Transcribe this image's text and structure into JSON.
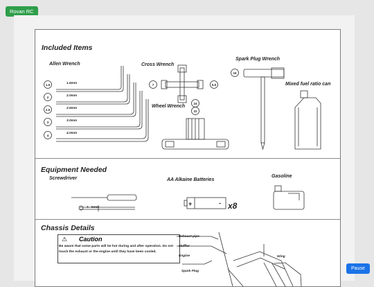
{
  "badge": "Rovan RC",
  "pause": "Pause",
  "included": {
    "title": "Included Items",
    "allen": "Allen Wrench",
    "allen_sizes": [
      {
        "num": "1.5",
        "size": "1.5mm"
      },
      {
        "num": "2",
        "size": "2.0mm"
      },
      {
        "num": "2.5",
        "size": "2.5mm"
      },
      {
        "num": "3",
        "size": "3.0mm"
      },
      {
        "num": "4",
        "size": "4.0mm"
      }
    ],
    "cross": "Cross Wrench",
    "cross_sizes": [
      "7",
      "5.5"
    ],
    "spark": "Spark Plug Wrench",
    "spark_size": "16",
    "wheel": "Wheel Wrench",
    "wheel_sizes": [
      "24",
      "22"
    ],
    "fuel": "Mixed fuel ratio can"
  },
  "equipment": {
    "title": "Equipment Needed",
    "screwdriver": "Screwdriver",
    "screw_size": "4 - 5mm",
    "batteries": "AA  Alkaine Batteries",
    "battery_count": "x8",
    "gasoline": "Gasoline"
  },
  "chassis": {
    "title": "Chassis Details",
    "caution_title": "Caution",
    "caution_text": "Be aware that some parts will be hot during and after operation. Do not touch the exhaust or the engine until they have been cooled.",
    "callouts": [
      "Exhaust pipe",
      "Muffler",
      "Engine",
      "Spark Plug",
      "Wing"
    ]
  }
}
